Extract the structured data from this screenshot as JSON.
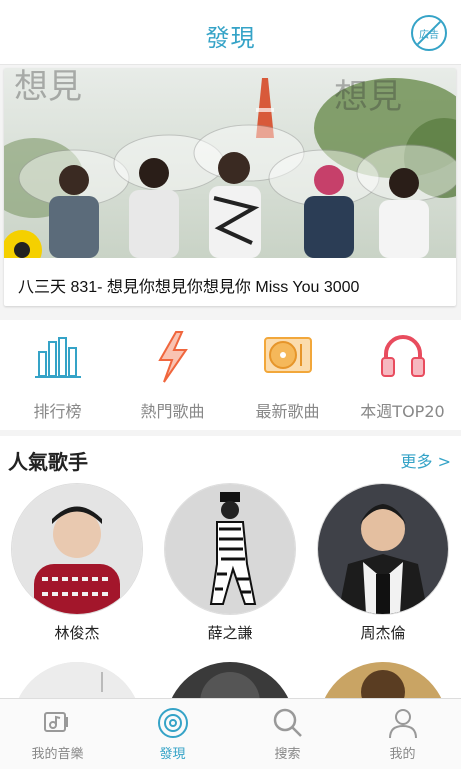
{
  "header": {
    "title": "發現",
    "ad_label": "広告"
  },
  "banner": {
    "caption": "八三天 831- 想見你想見你想見你 Miss You 3000"
  },
  "quick_links": [
    {
      "label": "排行榜",
      "icon": "bar-chart-icon",
      "color": "#35a3c7"
    },
    {
      "label": "熱門歌曲",
      "icon": "lightning-icon",
      "color": "#f0663d"
    },
    {
      "label": "最新歌曲",
      "icon": "vinyl-record-icon",
      "color": "#f2a73a"
    },
    {
      "label": "本週TOP20",
      "icon": "headphones-icon",
      "color": "#e84c5e"
    }
  ],
  "popular_artists": {
    "title": "人氣歌手",
    "more_label": "更多 >",
    "artists": [
      {
        "name": "林俊杰"
      },
      {
        "name": "薛之謙"
      },
      {
        "name": "周杰倫"
      }
    ]
  },
  "tabbar": {
    "items": [
      {
        "label": "我的音樂",
        "icon": "music-library-icon"
      },
      {
        "label": "發現",
        "icon": "disc-icon",
        "active": true
      },
      {
        "label": "搜索",
        "icon": "search-icon"
      },
      {
        "label": "我的",
        "icon": "profile-icon"
      }
    ]
  },
  "colors": {
    "accent": "#35a3c7"
  }
}
